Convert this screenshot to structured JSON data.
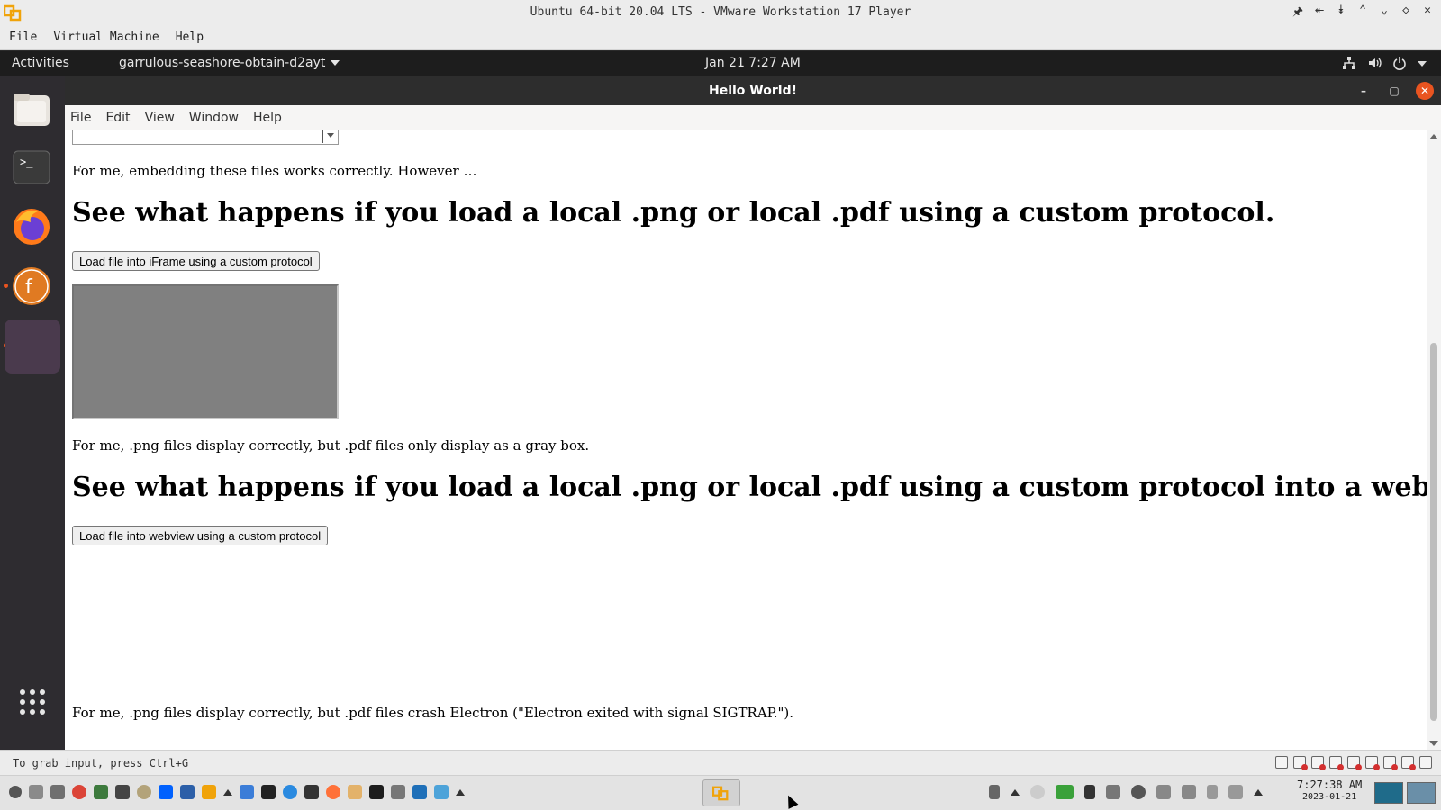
{
  "vm": {
    "title": "Ubuntu 64-bit 20.04 LTS - VMware Workstation 17 Player",
    "controls": [
      "pin-icon",
      "chevron-up-double-icon",
      "chevron-down-double-icon",
      "chevron-up-icon",
      "chevron-down-icon",
      "diamond-icon",
      "close-icon"
    ],
    "menu": [
      "File",
      "Virtual Machine",
      "Help"
    ],
    "status_hint": "To grab input, press Ctrl+G"
  },
  "gnome": {
    "activities": "Activities",
    "app_menu": "garrulous-seashore-obtain-d2ayt",
    "clock": "Jan 21  7:27 AM",
    "tray": [
      "network-icon",
      "volume-icon",
      "power-icon"
    ]
  },
  "dock": {
    "items": [
      "files-icon",
      "terminal-icon",
      "firefox-icon",
      "fritzing-icon",
      "electron-app-icon"
    ],
    "show_apps": "show-applications-icon"
  },
  "app": {
    "title": "Hello World!",
    "menu": [
      "File",
      "Edit",
      "View",
      "Window",
      "Help"
    ],
    "para1": "For me, embedding these files works correctly. However …",
    "heading1": "See what happens if you load a local .png or local .pdf using a custom protocol.",
    "button1": "Load file into iFrame using a custom protocol",
    "para2": "For me, .png files display correctly, but .pdf files only display as a gray box.",
    "heading2": "See what happens if you load a local .png or local .pdf using a custom protocol into a webview.",
    "button2": "Load file into webview using a custom protocol",
    "para3": "For me, .png files display correctly, but .pdf files crash Electron (\"Electron exited with signal SIGTRAP.\")."
  },
  "taskbar": {
    "time": "7:27:38 AM",
    "date": "2023-01-21"
  },
  "colors": {
    "ubuntu_orange": "#e95420",
    "dock_bg": "#2e2c30",
    "iframe_gray": "#808080"
  }
}
